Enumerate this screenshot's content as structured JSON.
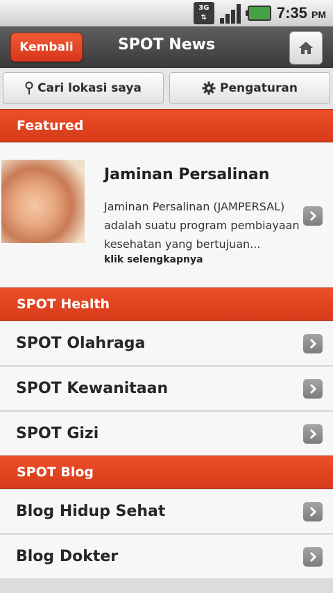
{
  "status_bar": {
    "network": "3G",
    "time": "7:35",
    "ampm": "PM"
  },
  "header": {
    "back_label": "Kembali",
    "title": "SPOT News"
  },
  "toolbar": {
    "location_label": "Cari lokasi saya",
    "settings_label": "Pengaturan"
  },
  "featured": {
    "section_title": "Featured",
    "title": "Jaminan Persalinan",
    "description": "Jaminan Persalinan (JAMPERSAL) adalah suatu program pembiayaan kesehatan yang bertujuan...",
    "more_label": "klik selengkapnya"
  },
  "health": {
    "section_title": "SPOT Health",
    "items": [
      {
        "label": "SPOT Olahraga"
      },
      {
        "label": "SPOT Kewanitaan"
      },
      {
        "label": "SPOT Gizi"
      }
    ]
  },
  "blog": {
    "section_title": "SPOT Blog",
    "items": [
      {
        "label": "Blog Hidup Sehat"
      },
      {
        "label": "Blog Dokter"
      }
    ]
  },
  "colors": {
    "accent": "#e2431f",
    "header": "#4a4a4a",
    "background": "#f7f7f7"
  }
}
